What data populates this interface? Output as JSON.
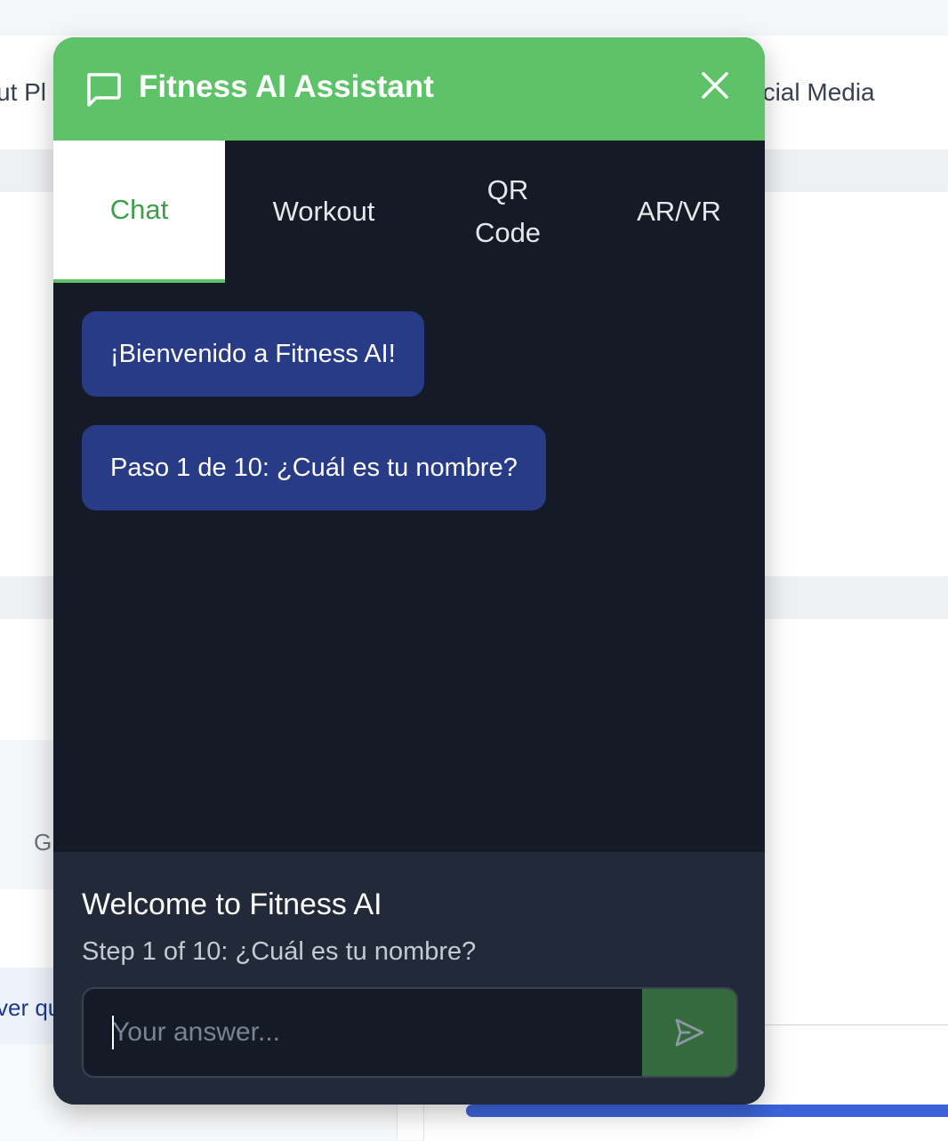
{
  "background": {
    "nav_left_text": "ut Pl",
    "nav_right_text": "ocial Media",
    "partial_text": "G",
    "partial_link": "ver qu"
  },
  "widget": {
    "title": "Fitness AI Assistant",
    "header_color": "#5ec368",
    "icons": {
      "header": "chat-bubble-icon",
      "close": "close-icon",
      "send": "send-icon"
    },
    "tabs": [
      {
        "label": "Chat",
        "active": true
      },
      {
        "label": "Workout",
        "active": false
      },
      {
        "label": "QR Code",
        "active": false
      },
      {
        "label": "AR/VR",
        "active": false
      }
    ],
    "messages": [
      {
        "text": "¡Bienvenido a Fitness AI!"
      },
      {
        "text": "Paso 1 de 10: ¿Cuál es tu nombre?"
      }
    ],
    "footer": {
      "title": "Welcome to Fitness AI",
      "step": "Step 1 of 10: ¿Cuál es tu nombre?",
      "input_placeholder": "Your answer...",
      "input_value": ""
    }
  }
}
